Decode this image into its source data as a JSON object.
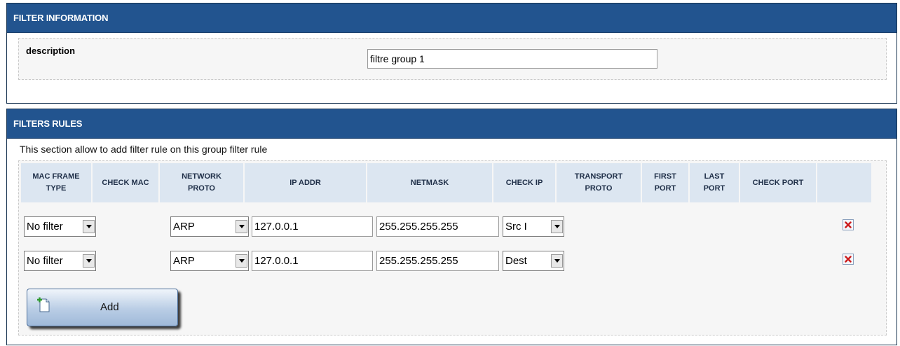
{
  "filter_information": {
    "title": "FILTER INFORMATION",
    "description_label": "description",
    "description_value": "filtre group 1"
  },
  "filters_rules": {
    "title": "FILTERS RULES",
    "intro": "This section allow to add filter rule on this group filter rule",
    "columns": [
      "MAC FRAME\nTYPE",
      "CHECK MAC",
      "NETWORK\nPROTO",
      "IP ADDR",
      "NETMASK",
      "CHECK IP",
      "TRANSPORT\nPROTO",
      "FIRST\nPORT",
      "LAST\nPORT",
      "CHECK PORT",
      ""
    ],
    "rows": [
      {
        "mac_frame_type": "No filter",
        "network_proto": "ARP",
        "ip_addr": "127.0.0.1",
        "netmask": "255.255.255.255",
        "check_ip": "Src I"
      },
      {
        "mac_frame_type": "No filter",
        "network_proto": "ARP",
        "ip_addr": "127.0.0.1",
        "netmask": "255.255.255.255",
        "check_ip": "Dest"
      }
    ],
    "add_label": "Add"
  },
  "icons": {
    "delete": "delete-icon",
    "add": "add-document-icon",
    "dropdown": "chevron-down-icon"
  },
  "colors": {
    "header_bg": "#22548f",
    "column_header_bg": "#dce6f1",
    "delete_red": "#cc1a1a"
  }
}
